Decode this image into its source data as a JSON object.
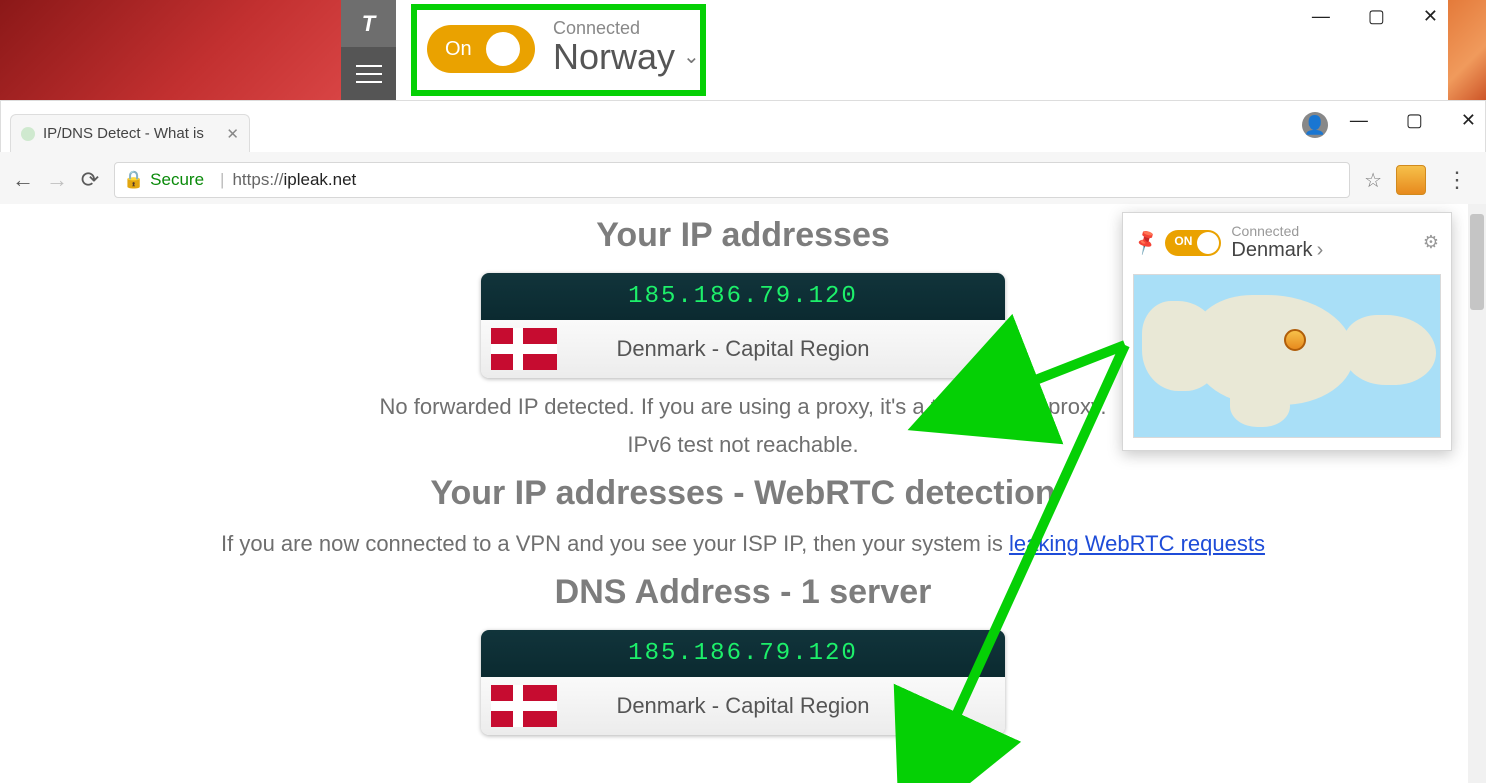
{
  "vpn_app": {
    "logo": "T",
    "toggle_label": "On",
    "status_label": "Connected",
    "country": "Norway"
  },
  "vpn_app_window": {
    "min": "—",
    "max": "▢",
    "close": "✕"
  },
  "chrome": {
    "tab_title": "IP/DNS Detect - What is",
    "secure_label": "Secure",
    "url_scheme": "https://",
    "url_host": "ipleak.net",
    "window": {
      "min": "—",
      "max": "▢",
      "close": "✕"
    }
  },
  "page": {
    "h1": "Your IP addresses",
    "ip1": "185.186.79.120",
    "loc1": "Denmark - Capital Region",
    "forward_msg": "No forwarded IP detected. If you are using a proxy, it's a transparent proxy.",
    "ipv6_msg": "IPv6 test not reachable.",
    "h2": "Your IP addresses - WebRTC detection",
    "webrtc_msg_pre": "If you are now connected to a VPN and you see your ISP IP, then your system is ",
    "webrtc_link": "leaking WebRTC requests",
    "h3": "DNS Address - 1 server",
    "dns_ip": "185.186.79.120",
    "dns_loc": "Denmark - Capital Region"
  },
  "ext_popup": {
    "toggle_label": "ON",
    "status_label": "Connected",
    "country": "Denmark"
  }
}
